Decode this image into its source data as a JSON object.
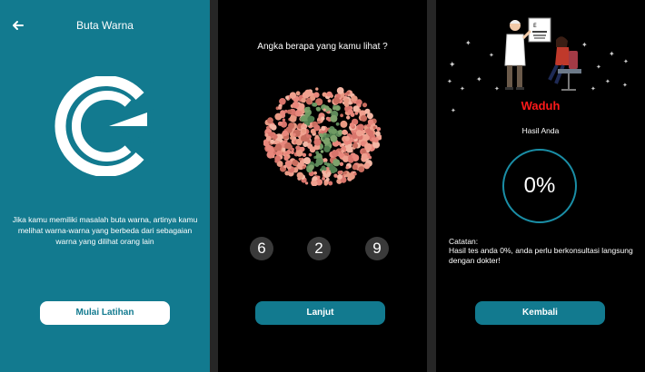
{
  "screen1": {
    "title": "Buta Warna",
    "description": "Jika kamu memiliki masalah buta warna, artinya kamu melihat warna-warna yang berbeda dari sebagaian warna yang dilihat orang lain",
    "start_button": "Mulai Latihan",
    "colors": {
      "background": "#127a8f",
      "button_bg": "#ffffff",
      "button_text": "#127a8f"
    }
  },
  "screen2": {
    "question": "Angka berapa yang kamu lihat ?",
    "plate_icon": "color-blind-test-plate-icon",
    "answers": [
      "6",
      "2",
      "9"
    ],
    "next_button": "Lanjut",
    "colors": {
      "background": "#000000",
      "accent": "#127a8f",
      "option_bg": "#3a3a3a"
    }
  },
  "screen3": {
    "illustration_icon": "eye-doctor-illustration",
    "result_title": "Waduh",
    "result_label": "Hasil Anda",
    "score": "0%",
    "note_label": "Catatan:",
    "note_text": "Hasil tes anda 0%, anda perlu berkonsultasi langsung dengan dokter!",
    "back_button": "Kembali",
    "colors": {
      "background": "#000000",
      "result_title": "#ff1a1a",
      "ring": "#1a8ea6",
      "accent": "#127a8f"
    }
  }
}
